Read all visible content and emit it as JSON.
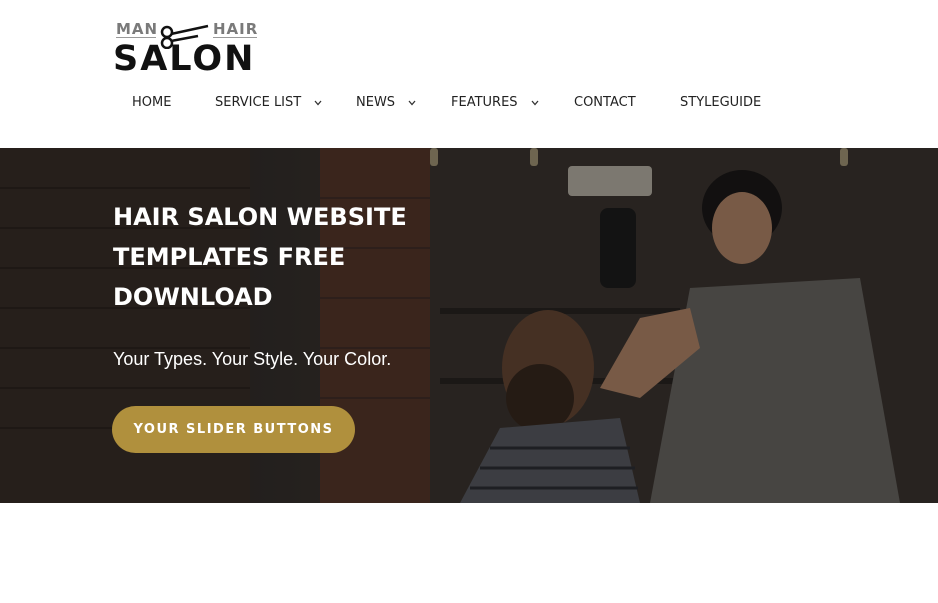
{
  "logo": {
    "top_left": "MAN",
    "top_right": "HAIR",
    "main": "SALON"
  },
  "nav": {
    "items": [
      {
        "label": "HOME",
        "has_dropdown": false
      },
      {
        "label": "SERVICE LIST",
        "has_dropdown": true
      },
      {
        "label": "NEWS",
        "has_dropdown": true
      },
      {
        "label": "FEATURES",
        "has_dropdown": true
      },
      {
        "label": "CONTACT",
        "has_dropdown": false
      },
      {
        "label": "STYLEGUIDE",
        "has_dropdown": false
      }
    ]
  },
  "hero": {
    "title_line1": "HAIR SALON WEBSITE",
    "title_line2": "TEMPLATES FREE",
    "title_line3": "DOWNLOAD",
    "subtitle": "Your Types. Your Style. Your Color.",
    "button_label": "YOUR SLIDER BUTTONS"
  },
  "colors": {
    "accent": "#b0903d",
    "text_dark": "#222222",
    "hero_text": "#ffffff"
  }
}
